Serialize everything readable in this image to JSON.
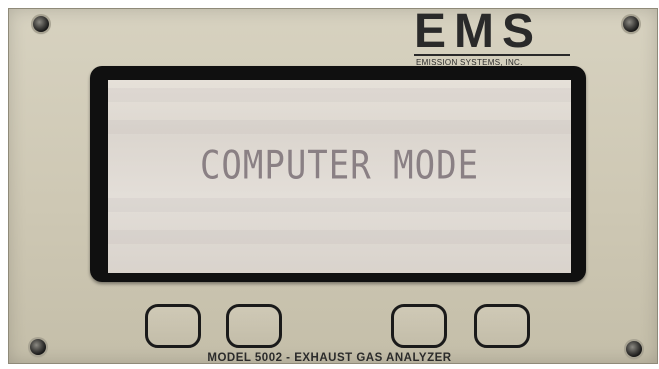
{
  "brand": {
    "logo_text": "EMS",
    "subtitle": "EMISSION SYSTEMS, INC."
  },
  "display": {
    "message": "COMPUTER MODE"
  },
  "buttons": [
    {
      "id": "button-1"
    },
    {
      "id": "button-2"
    },
    {
      "id": "button-3"
    },
    {
      "id": "button-4"
    }
  ],
  "footer": {
    "model_label": "MODEL 5002 - EXHAUST GAS ANALYZER"
  },
  "colors": {
    "panel": "#d2ccb9",
    "bezel": "#101010",
    "lcd_background": "#e1dcd5",
    "lcd_text": "#8a8084"
  }
}
